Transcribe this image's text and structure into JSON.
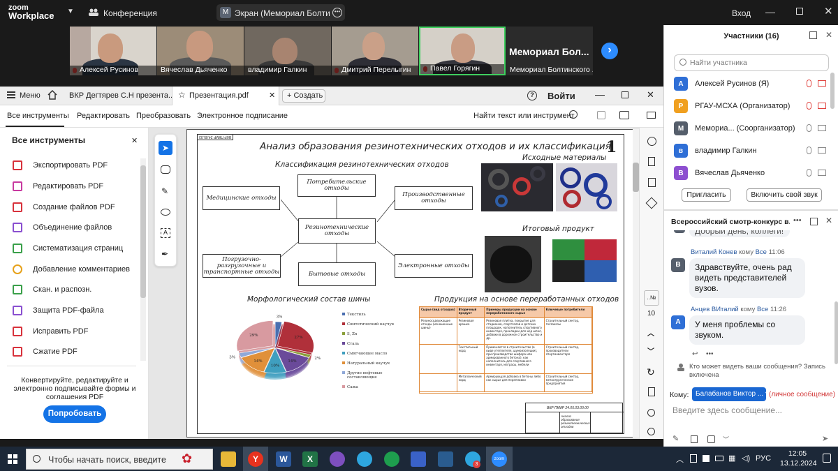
{
  "zoom": {
    "logo_top": "zoom",
    "logo_bottom": "Workplace",
    "meeting_label": "Конференция",
    "share_avatar": "M",
    "share_label": "Экран (Мемориал Болтинског",
    "signin": "Вход"
  },
  "videos": [
    {
      "name": "Алексей Русинов",
      "muted": true
    },
    {
      "name": "Вячеслав Дьяченко",
      "muted": false
    },
    {
      "name": "владимир Галкин",
      "muted": false
    },
    {
      "name": "Дмитрий Перелыгин",
      "muted": true
    },
    {
      "name": "Павел Горягин",
      "muted": true,
      "active": true
    },
    {
      "name": "Мемориал Болтинского ...",
      "big_label": "Мемориал Бол...",
      "muted": false
    }
  ],
  "acrobat": {
    "menu": "Меню",
    "tabs": [
      {
        "label": "ВКР Дегтярев С.Н презента..."
      },
      {
        "label": "Презентация.pdf",
        "active": true
      }
    ],
    "new_tab": "Создать",
    "signin": "Войти",
    "toolbar": {
      "all_tools": "Все инструменты",
      "edit": "Редактировать",
      "convert": "Преобразовать",
      "esign": "Электронное подписание",
      "find": "Найти текст или инструмент"
    },
    "panel_title": "Все инструменты",
    "panel_items": [
      "Экспортировать PDF",
      "Редактировать PDF",
      "Создание файлов PDF",
      "Объединение файлов",
      "Систематизация страниц",
      "Добавление комментариев",
      "Скан. и распозн.",
      "Защита PDF-файла",
      "Исправить PDF",
      "Сжатие PDF"
    ],
    "promo_text": "Конвертируйте, редактируйте и электронно подписывайте формы и соглашения PDF",
    "promo_button": "Попробовать",
    "page_indicator": "10"
  },
  "slide": {
    "title": "Анализ образования резинотехнических отходов и их классификация",
    "slide_number": "1",
    "classification_title": "Классификация резинотехнических отходов",
    "center_box": "Резинотехнические отходы",
    "boxes": {
      "consumer": "Потребительские отходы",
      "medical": "Медицинские отходы",
      "production": "Производственные отходы",
      "loading": "Погрузочно-разгрузочные и транспортные отходы",
      "household": "Бытовые отходы",
      "electronic": "Электронные отходы"
    },
    "raw_title": "Исходные материалы",
    "final_title": "Итоговый продукт",
    "morph_title": "Морфологический состав шины",
    "products_title": "Продукция на основе переработанных отходов",
    "corner_stamp": "ВКР ПКМР 24.05.03",
    "footer_code": "ВКР ПКМР 24.05.03.00.00",
    "footer_title": "Анализ образования резинотехнических отходов"
  },
  "chart_data": {
    "type": "pie",
    "title": "Морфологический состав шины",
    "categories": [
      "Текстиль",
      "Синтетический каучук",
      "S, Zn",
      "Сталь",
      "Смягчающее масло",
      "Натуральный каучук",
      "Другие вефтевые составляющие",
      "Сажа"
    ],
    "values": [
      3,
      27,
      2,
      14,
      10,
      14,
      3,
      29
    ],
    "colors": [
      "#4a6fb0",
      "#b0303a",
      "#8a9f3a",
      "#6a4a9a",
      "#3f9fbf",
      "#e0903a",
      "#8fa8d8",
      "#d89aa0"
    ],
    "data_labels": [
      "3%",
      "27%",
      "2%",
      "14%",
      "10%",
      "14%",
      "3%",
      "29%"
    ]
  },
  "table": {
    "headers": [
      "Сырье (вид отходов)",
      "Вторичный продукт",
      "Примеры продукции на основе переработанного сырья",
      "Ключевые потребители"
    ],
    "rows": [
      [
        "Резиносодержащие отходы (изношенные шины)",
        "Резиновая крошка",
        "Резиновая плитка, покрытие для стадионов, спортзалов и детских площадок, наполнитель спортивного инвентаря, прокладки для ж/д шпал, добавки в дорожное строительство и др.",
        "Строительный сектор, госзаказы"
      ],
      [
        "",
        "Текстильный корд",
        "Применяется в строительстве (в виде утеплителя, шумоизоляции), при производстве шифера или армированного бетона), как наполнитель для спортивного инвентаря, матрасы, мебели",
        "Строительный сектор, производители спортинвентаря"
      ],
      [
        "",
        "Металлический корд",
        "Армирующая добавка в бетоны либо как сырье для переплавки",
        "Строительный сектор, металлургические предприятия"
      ]
    ]
  },
  "participants": {
    "title": "Участники (16)",
    "search_placeholder": "Найти участника",
    "list": [
      {
        "initial": "А",
        "name": "Алексей Русинов (Я)",
        "color": "#2f6fd6",
        "muted": true
      },
      {
        "initial": "Р",
        "name": "РГАУ-МСХА (Организатор)",
        "color": "#f0a020",
        "muted": true
      },
      {
        "initial": "М",
        "name": "Мемориа... (Соорганизатор)",
        "color": "#555e6b",
        "muted": false
      },
      {
        "initial": "в",
        "name": "владимир Галкин",
        "color": "#2f6fd6",
        "muted": false
      },
      {
        "initial": "В",
        "name": "Вячеслав Дьяченко",
        "color": "#8d4fd0",
        "muted": false
      }
    ],
    "invite_button": "Пригласить",
    "sound_button": "Включить свой звук"
  },
  "chat": {
    "title": "Всероссийский смотр-конкурс в...",
    "cut_message": "Добрый день, коллеги!",
    "messages": [
      {
        "initial": "В",
        "sender": "Виталий Конев",
        "to_word": "кому",
        "to": "Все",
        "time": "11:06",
        "text": "Здравствуйте, очень рад видеть представителей вузов.",
        "color": "#555e6b"
      },
      {
        "initial": "А",
        "sender": "Анцев ВИталий",
        "to_word": "кому",
        "to": "Все",
        "time": "11:26",
        "text": "У меня проблемы со звуком.",
        "color": "#2f6fd6"
      }
    ],
    "visibility": "Кто может видеть ваши сообщения? Запись включена",
    "to_label": "Кому:",
    "recipient": "Балабанов Виктор ...",
    "private": "(личное сообщение)",
    "input_placeholder": "Введите здесь сообщение..."
  },
  "taskbar": {
    "search_placeholder": "Чтобы начать поиск, введите",
    "language": "РУС",
    "time": "12:05",
    "date": "13.12.2024",
    "telegram_badge": "3"
  }
}
